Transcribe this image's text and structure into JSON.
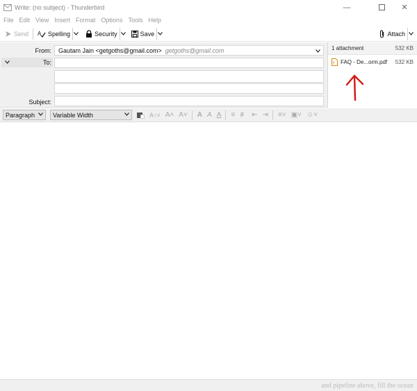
{
  "window": {
    "title": "Write: (no subject) - Thunderbird"
  },
  "menu": [
    "File",
    "Edit",
    "View",
    "Insert",
    "Format",
    "Options",
    "Tools",
    "Help"
  ],
  "toolbar": {
    "send_label": "Send",
    "spelling_label": "Spelling",
    "security_label": "Security",
    "save_label": "Save",
    "attach_label": "Attach"
  },
  "header": {
    "from_label": "From:",
    "from_value": "Gautam Jain <getgoths@gmail.com>",
    "from_identity": "getgoths@gmail.com",
    "to_label": "To:",
    "subject_label": "Subject:"
  },
  "attachments": {
    "header": "1 attachment",
    "total_size": "532 KB",
    "items": [
      {
        "name": "FAQ - De...orm.pdf",
        "size": "532 KB"
      }
    ]
  },
  "format": {
    "paragraph_value": "Paragraph",
    "font_value": "Variable Width"
  },
  "statusbar": {
    "text": "and pipeline above, fill the ocean"
  },
  "colors": {
    "annotation": "#d0201a",
    "accent": "#d68a12"
  }
}
